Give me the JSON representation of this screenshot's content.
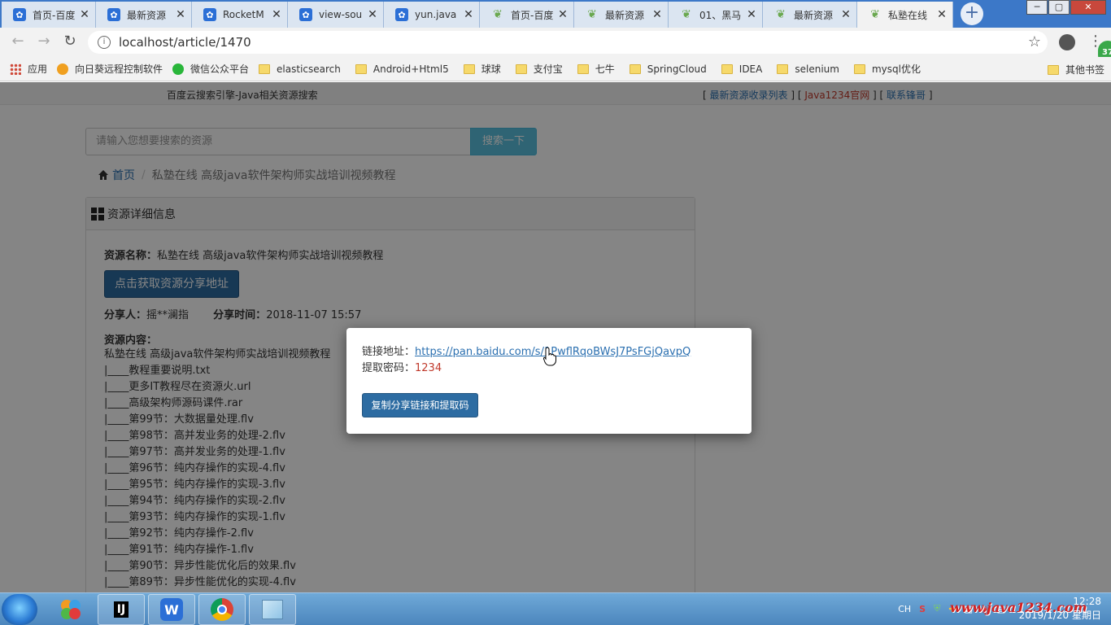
{
  "browser": {
    "tabs": [
      {
        "title": "首页-百度",
        "icon": "paw-icon"
      },
      {
        "title": "最新资源",
        "icon": "paw-icon"
      },
      {
        "title": "RocketM",
        "icon": "paw-icon"
      },
      {
        "title": "view-sou",
        "icon": "paw-icon"
      },
      {
        "title": "yun.java",
        "icon": "paw-icon"
      },
      {
        "title": "首页-百度",
        "icon": "leaf-icon"
      },
      {
        "title": "最新资源",
        "icon": "leaf-icon"
      },
      {
        "title": "01、黑马",
        "icon": "leaf-icon"
      },
      {
        "title": "最新资源",
        "icon": "leaf-icon"
      },
      {
        "title": "私塾在线",
        "icon": "leaf-icon",
        "active": true
      }
    ],
    "url": "localhost/article/1470",
    "extension_badge": "37",
    "bookmarks": [
      "应用",
      "向日葵远程控制软件",
      "微信公众平台",
      "elasticsearch",
      "Android+Html5",
      "球球",
      "支付宝",
      "七牛",
      "SpringCloud",
      "IDEA",
      "selenium",
      "mysql优化"
    ],
    "other_bookmarks": "其他书签"
  },
  "site": {
    "top_title": "百度云搜索引擎-Java相关资源搜索",
    "top_links": {
      "open": "[ ",
      "link1": "最新资源收录列表",
      "mid1": " ] [ ",
      "link2": "Java1234官网",
      "mid2": " ] [ ",
      "link3": "联系锋哥",
      "close": " ]"
    },
    "search_placeholder": "请输入您想要搜索的资源",
    "search_button": "搜索一下",
    "breadcrumb_home": "首页",
    "breadcrumb_current": "私塾在线 高级java软件架构师实战培训视频教程",
    "panel_title": "资源详细信息",
    "resource_name_label": "资源名称：",
    "resource_name": "私塾在线 高级java软件架构师实战培训视频教程",
    "get_link_button": "点击获取资源分享地址",
    "sharer_label": "分享人：",
    "sharer": "摇**澜指",
    "share_time_label": "分享时间：",
    "share_time": "2018-11-07 15:57",
    "content_label": "资源内容：",
    "content_lines": [
      "私塾在线 高级java软件架构师实战培训视频教程",
      "|____教程重要说明.txt",
      "|____更多IT教程尽在资源火.url",
      "|____高级架构师源码课件.rar",
      "|____第99节：大数据量处理.flv",
      "|____第98节：高并发业务的处理-2.flv",
      "|____第97节：高并发业务的处理-1.flv",
      "|____第96节：纯内存操作的实现-4.flv",
      "|____第95节：纯内存操作的实现-3.flv",
      "|____第94节：纯内存操作的实现-2.flv",
      "|____第93节：纯内存操作的实现-1.flv",
      "|____第92节：纯内存操作-2.flv",
      "|____第91节：纯内存操作-1.flv",
      "|____第90节：异步性能优化后的效果.flv",
      "|____第89节：异步性能优化的实现-4.flv"
    ]
  },
  "modal": {
    "link_label": "链接地址：",
    "link_url": "https://pan.baidu.com/s/1PwflRqoBWsJ7PsFGjQavpQ",
    "code_label": "提取密码：",
    "code": "1234",
    "copy_button": "复制分享链接和提取码"
  },
  "taskbar": {
    "ide_label": "IJ",
    "tray_lang": "CH",
    "watermark": "www.java1234.com",
    "time": "12:28",
    "date": "2019/1/20 星期日"
  },
  "colors": {
    "link_blue": "#2a6fb0",
    "code_red": "#c0392b",
    "primary_button": "#2d6ca2",
    "search_button": "#5bc0de"
  }
}
